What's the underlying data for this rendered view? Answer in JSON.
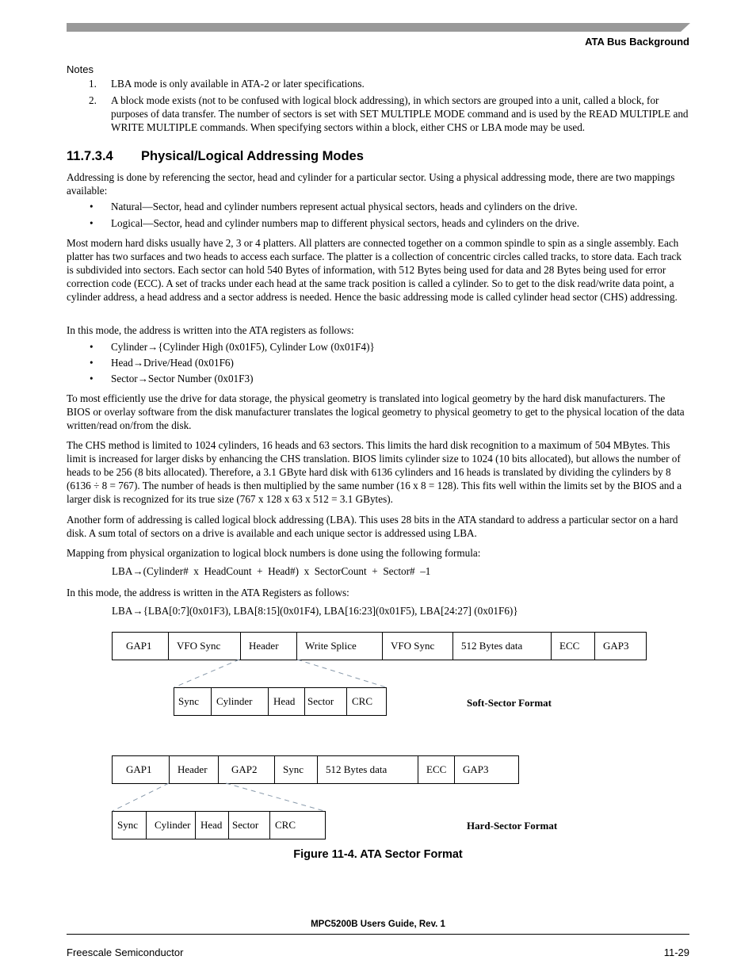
{
  "header": {
    "section_title": "ATA Bus Background",
    "bar_color": "#999999"
  },
  "notes": {
    "label": "Notes",
    "items": [
      {
        "num": "1.",
        "text": "LBA mode is only available in ATA-2 or later specifications."
      },
      {
        "num": "2.",
        "text": "A block mode exists (not to be confused with logical block addressing), in which sectors are grouped into a unit, called a block, for purposes of data transfer. The number of sectors is set with SET MULTIPLE MODE command and is used by the READ MULTIPLE and WRITE MULTIPLE commands. When specifying sectors within a block, either CHS or LBA mode may be used."
      }
    ]
  },
  "section": {
    "number": "11.7.3.4",
    "title": "Physical/Logical Addressing Modes",
    "intro": "Addressing is done by referencing the sector, head and cylinder for a particular sector. Using a physical addressing mode, there are two mappings available:",
    "mapping_bullets": [
      "Natural—Sector, head and cylinder numbers represent actual physical sectors, heads and cylinders on the drive.",
      "Logical—Sector, head and cylinder numbers map to different physical sectors, heads and cylinders on the drive."
    ],
    "para_platters": "Most modern hard disks usually have 2, 3 or 4 platters. All platters are connected together on a common spindle to spin as a single assembly. Each platter has two surfaces and two heads to access each surface. The platter is a collection of concentric circles called tracks, to store data. Each track is subdivided into sectors. Each sector can hold 540 Bytes of information, with 512 Bytes being used for data and 28 Bytes being used for error correction code (ECC). A set of tracks under each head at the same track position is called a cylinder. So to get to the disk read/write data point, a cylinder address, a head address and a sector address is needed. Hence the basic addressing mode is called cylinder head sector (CHS) addressing.",
    "para_chs_regs_intro": "In this mode, the address is written into the ATA registers as follows:",
    "chs_register_bullets": [
      "Cylinder→{Cylinder High (0x01F5), Cylinder Low (0x01F4)}",
      "Head→Drive/Head (0x01F6)",
      "Sector→Sector Number (0x01F3)"
    ],
    "para_translation": "To most efficiently use the drive for data storage, the physical geometry is translated into logical geometry by the hard disk manufacturers. The BIOS or overlay software from the disk manufacturer translates the logical geometry to physical geometry to get to the physical location of the data written/read on/from the disk.",
    "para_chs_limit": "The CHS method is limited to 1024 cylinders, 16 heads and 63 sectors. This limits the hard disk recognition to a maximum of 504 MBytes. This limit is increased for larger disks by enhancing the CHS translation. BIOS limits cylinder size to 1024 (10 bits allocated), but allows the number of heads to be 256 (8 bits allocated). Therefore, a 3.1 GByte hard disk with 6136 cylinders and 16 heads is translated by dividing the cylinders by 8 (6136 ÷ 8 = 767). The number of heads is then multiplied by the same number (16 x 8 = 128). This fits well within the limits set by the BIOS and a larger disk is recognized for its true size (767 x 128 x 63 x 512 = 3.1 GBytes).",
    "para_lba": "Another form of addressing is called logical block addressing (LBA). This uses 28 bits in the ATA standard to address a particular sector on a hard disk. A sum total of sectors on a drive is available and each unique sector is addressed using LBA.",
    "para_mapping": "Mapping from physical organization to logical block numbers is done using the following formula:",
    "formula": "LBA→(Cylinder#  x  HeadCount  +  Head#)  x  SectorCount  +  Sector#  –1",
    "para_lba_regs_intro": "In this mode, the address is written in the ATA Registers as follows:",
    "lba_registers": "LBA→{LBA[0:7](0x01F3), LBA[8:15](0x01F4), LBA[16:23](0x01F5), LBA[24:27] (0x01F6)}"
  },
  "figure": {
    "soft_sector": {
      "label": "Soft-Sector Format",
      "fields": [
        "GAP1",
        "VFO Sync",
        "Header",
        "Write Splice",
        "VFO Sync",
        "512 Bytes data",
        "ECC",
        "GAP3"
      ],
      "header_fields": [
        "Sync",
        "Cylinder",
        "Head",
        "Sector",
        "CRC"
      ]
    },
    "hard_sector": {
      "label": "Hard-Sector Format",
      "fields": [
        "GAP1",
        "Header",
        "GAP2",
        "Sync",
        "512 Bytes data",
        "ECC",
        "GAP3"
      ],
      "header_fields": [
        "Sync",
        "Cylinder",
        "Head",
        "Sector",
        "CRC"
      ]
    },
    "caption": "Figure 11-4. ATA Sector Format"
  },
  "footer": {
    "doc_title": "MPC5200B Users Guide, Rev. 1",
    "company": "Freescale Semiconductor",
    "page_number": "11-29"
  }
}
